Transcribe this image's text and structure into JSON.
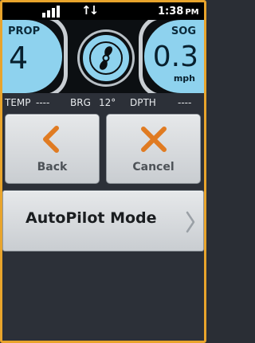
{
  "status_bar": {
    "signal_icon": "signal-bars-icon",
    "data_icon": "data-transfer-icon",
    "data_glyph": "↑↓",
    "time": "1:38",
    "ampm": "PM"
  },
  "gauges": {
    "prop": {
      "label": "PROP",
      "value": "4"
    },
    "center_icon": "propeller-icon",
    "sog": {
      "label": "SOG",
      "value": "0.3",
      "unit": "mph"
    }
  },
  "info_line": {
    "temp_label": "TEMP",
    "temp_value": "----",
    "brg_label": "BRG",
    "brg_value": "12°",
    "dpth_label": "DPTH",
    "dpth_value": "----"
  },
  "buttons": {
    "back": {
      "label": "Back",
      "icon": "chevron-left-icon"
    },
    "cancel": {
      "label": "Cancel",
      "icon": "close-icon"
    },
    "autopilot": {
      "label": "AutoPilot Mode",
      "icon": "chevron-right-icon"
    }
  },
  "colors": {
    "accent": "#e8a42c",
    "gauge_fill": "#8ed2ee",
    "icon_orange": "#e07b22"
  }
}
